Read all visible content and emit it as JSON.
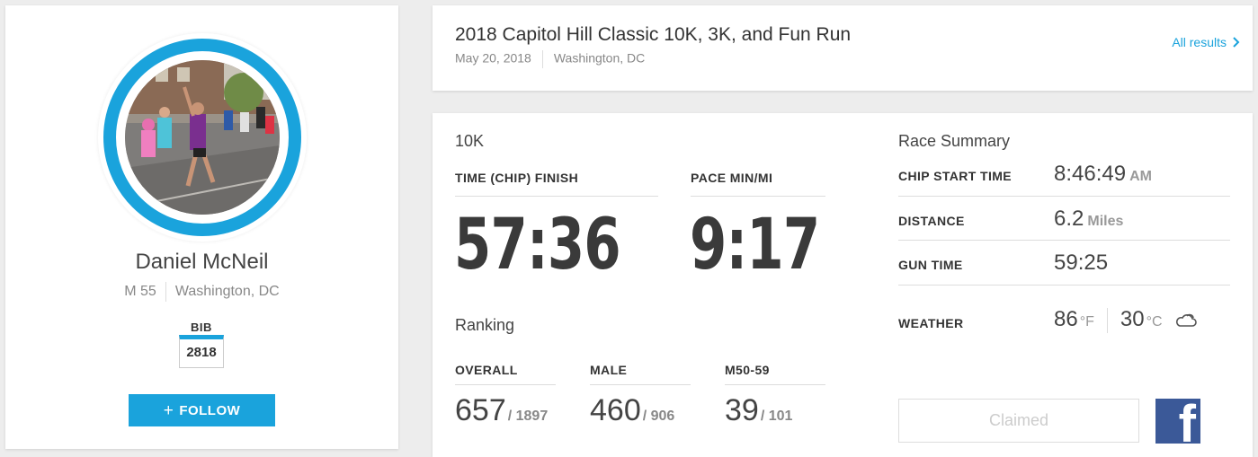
{
  "profile": {
    "name": "Daniel McNeil",
    "gender_age": "M 55",
    "location": "Washington, DC",
    "bib_label": "BIB",
    "bib_number": "2818",
    "follow_plus": "+",
    "follow_label": "FOLLOW",
    "accent_color": "#1aa3dc"
  },
  "event": {
    "title": "2018 Capitol Hill Classic 10K, 3K, and Fun Run",
    "date": "May 20, 2018",
    "location": "Washington, DC",
    "all_results_label": "All results",
    "all_results_icon": "chevron-right-icon"
  },
  "result": {
    "race": "10K",
    "finish_label": "TIME (CHIP) FINISH",
    "finish_time": "57:36",
    "pace_label": "PACE MIN/MI",
    "pace": "9:17",
    "ranking_title": "Ranking",
    "rankings": [
      {
        "label": "OVERALL",
        "place": "657",
        "total": "/ 1897"
      },
      {
        "label": "MALE",
        "place": "460",
        "total": "/ 906"
      },
      {
        "label": "M50-59",
        "place": "39",
        "total": "/ 101"
      }
    ]
  },
  "summary": {
    "title": "Race Summary",
    "chip_start_label": "CHIP START TIME",
    "chip_start_value": "8:46:49",
    "chip_start_ampm": "AM",
    "distance_label": "DISTANCE",
    "distance_value": "6.2",
    "distance_unit": "Miles",
    "gun_time_label": "GUN TIME",
    "gun_time_value": "59:25",
    "weather_label": "WEATHER",
    "temp_f": "86",
    "temp_f_unit": "°F",
    "temp_c": "30",
    "temp_c_unit": "°C",
    "weather_icon": "partly-cloudy-icon",
    "claimed_label": "Claimed",
    "facebook_icon": "facebook-icon",
    "facebook_glyph": "f",
    "facebook_color": "#3b5998"
  }
}
